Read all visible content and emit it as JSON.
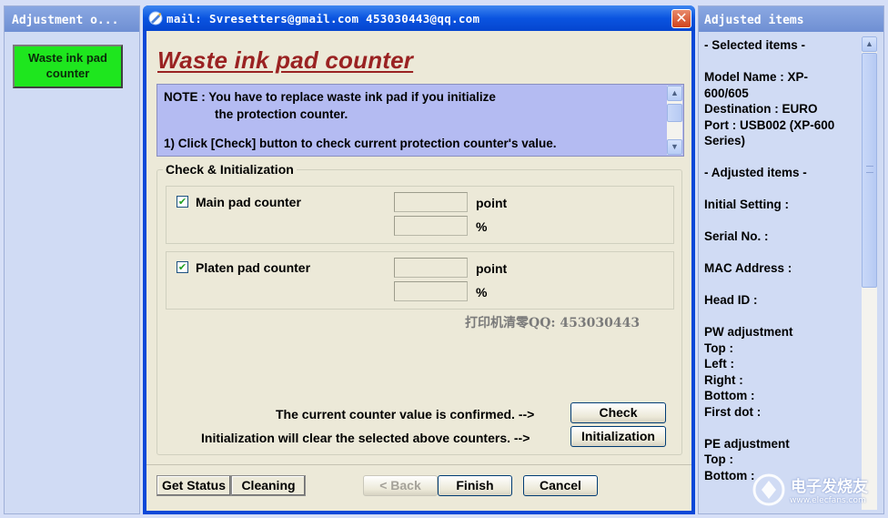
{
  "left_panel": {
    "title": "Adjustment o...",
    "item_label_line1": "Waste ink pad",
    "item_label_line2": "counter"
  },
  "dialog": {
    "title": "mail: Svresetters@gmail.com  453030443@qq.com",
    "close_glyph": "✕",
    "heading": "Waste ink pad counter",
    "note": {
      "line1": "NOTE : You have to replace waste ink pad if you initialize",
      "line2": "the protection counter.",
      "line3": "1) Click [Check] button to check current protection counter's value."
    },
    "group_title": "Check & Initialization",
    "counters": [
      {
        "label": "Main pad counter",
        "checked": true,
        "point_value": "",
        "percent_value": "",
        "unit_point": "point",
        "unit_percent": "%"
      },
      {
        "label": "Platen pad counter",
        "checked": true,
        "point_value": "",
        "percent_value": "",
        "unit_point": "point",
        "unit_percent": "%"
      }
    ],
    "watermark": "打印机清零QQ: 453030443",
    "check_line": "The current counter value is confirmed. -->",
    "check_button": "Check",
    "init_line": "Initialization will clear the selected above counters. -->",
    "init_button": "Initialization",
    "footer": {
      "get_status": "Get Status",
      "cleaning": "Cleaning",
      "back": "< Back",
      "finish": "Finish",
      "cancel": "Cancel"
    }
  },
  "right_panel": {
    "title": "Adjusted items",
    "items": [
      "- Selected items -",
      "",
      "Model Name : XP-\n600/605",
      "Destination : EURO",
      "Port : USB002 (XP-600\nSeries)",
      "",
      "- Adjusted items -",
      "",
      "Initial Setting :",
      "",
      "Serial No. :",
      "",
      "MAC Address :",
      "",
      "Head ID :",
      "",
      "PW adjustment",
      "Top :",
      "Left :",
      "Right :",
      "Bottom :",
      "First dot :",
      "",
      "PE adjustment",
      "Top :",
      "Bottom :"
    ]
  },
  "watermark_brand": {
    "name": "电子发烧友",
    "url": "www.elecfans.com"
  },
  "colors": {
    "title_bar": "#0a54e0",
    "waste_ink_item": "#1ee61e",
    "heading": "#9a2222",
    "note_bg": "#b4bbf2",
    "dialog_bg": "#ece9d8"
  }
}
